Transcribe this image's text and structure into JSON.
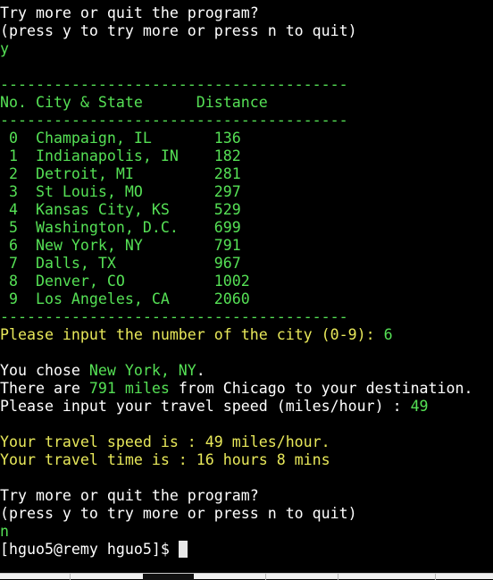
{
  "colors": {
    "background": "#000000",
    "text": "#ffffff",
    "green": "#55e055",
    "yellow": "#e8e85a"
  },
  "prompt1": {
    "question": "Try more or quit the program?",
    "hint": "(press y to try more or press n to quit)",
    "answer": "y"
  },
  "table": {
    "divider": "---------------------------------------",
    "header": "No. City & State      Distance",
    "rows": [
      {
        "text": " 0  Champaign, IL       136"
      },
      {
        "text": " 1  Indianapolis, IN    182"
      },
      {
        "text": " 2  Detroit, MI         281"
      },
      {
        "text": " 3  St Louis, MO        297"
      },
      {
        "text": " 4  Kansas City, KS     529"
      },
      {
        "text": " 5  Washington, D.C.    699"
      },
      {
        "text": " 6  New York, NY        791"
      },
      {
        "text": " 7  Dalls, TX           967"
      },
      {
        "text": " 8  Denver, CO          1002"
      },
      {
        "text": " 9  Los Angeles, CA     2060"
      }
    ]
  },
  "city_prompt": {
    "text": "Please input the number of the city (0-9): ",
    "answer": "6"
  },
  "result": {
    "chose_prefix": "You chose ",
    "chose_city": "New York, NY",
    "chose_suffix": ".",
    "there_prefix": "There are ",
    "miles": "791 miles",
    "there_suffix": " from Chicago to your destination.",
    "speed_prompt": "Please input your travel speed (miles/hour) : ",
    "speed_answer": "49",
    "speed_line": "Your travel speed is : 49 miles/hour.",
    "time_line": "Your travel time is : 16 hours 8 mins"
  },
  "prompt2": {
    "question": "Try more or quit the program?",
    "hint": "(press y to try more or press n to quit)",
    "answer": "n"
  },
  "shell_prompt": "[hguo5@remy hguo5]$ "
}
